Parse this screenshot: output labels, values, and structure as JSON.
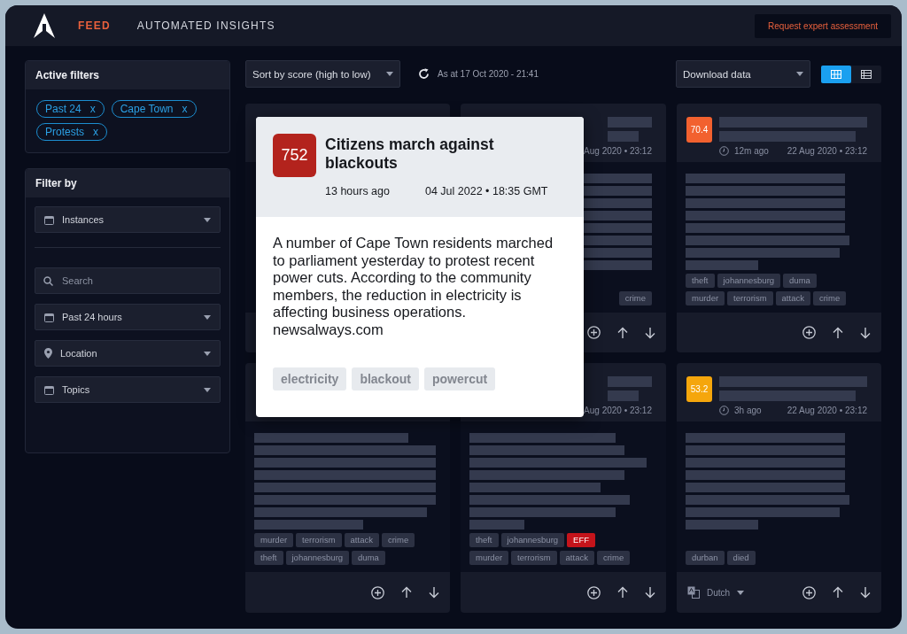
{
  "header": {
    "tabs": [
      {
        "label": "FEED",
        "selected": true
      },
      {
        "label": "AUTOMATED INSIGHTS",
        "selected": false
      }
    ],
    "action": "Request expert assessment"
  },
  "toolbar": {
    "sort": "Sort by score (high to low)",
    "timestamp": "As at 17 Oct 2020 - 21:41",
    "download": "Download data",
    "views": [
      {
        "kind": "grid",
        "selected": true
      },
      {
        "kind": "list",
        "selected": false
      }
    ]
  },
  "active_filters": {
    "title": "Active filters",
    "chips": [
      {
        "label": "Past 24",
        "remove": "x"
      },
      {
        "label": "Cape Town",
        "remove": "x"
      },
      {
        "label": "Protests",
        "remove": "x"
      }
    ]
  },
  "filter_by": {
    "title": "Filter by",
    "groups": [
      [
        {
          "kind": "select",
          "label": "Instances"
        }
      ],
      [
        {
          "kind": "search",
          "placeholder": "Search"
        },
        {
          "kind": "select",
          "label": "Past 24 hours"
        },
        {
          "kind": "location-select",
          "label": "Location"
        },
        {
          "kind": "select",
          "label": "Topics"
        }
      ]
    ]
  },
  "cards": [
    {
      "kind": "hidden"
    },
    {
      "kind": "left_hidden",
      "date": "Aug 2020 • 23:12",
      "tag_rows": [
        [
          {
            "label": "crime",
            "flagged": false
          }
        ]
      ]
    },
    {
      "kind": "full",
      "score": "70.4",
      "color": "#f2612f",
      "time_ago": "12m ago",
      "date": "22 Aug 2020 • 23:12",
      "tag_rows": [
        [
          {
            "label": "theft",
            "flagged": false
          },
          {
            "label": "johannesburg",
            "flagged": false
          },
          {
            "label": "duma",
            "flagged": false
          }
        ],
        [
          {
            "label": "murder",
            "flagged": false
          },
          {
            "label": "terrorism",
            "flagged": false
          },
          {
            "label": "attack",
            "flagged": false
          },
          {
            "label": "crime",
            "flagged": false
          }
        ]
      ]
    },
    {
      "kind": "header_hidden",
      "tag_rows": [
        [
          {
            "label": "murder",
            "flagged": false
          },
          {
            "label": "terrorism",
            "flagged": false
          },
          {
            "label": "attack",
            "flagged": false
          },
          {
            "label": "crime",
            "flagged": false
          }
        ],
        [
          {
            "label": "theft",
            "flagged": false
          },
          {
            "label": "johannesburg",
            "flagged": false
          },
          {
            "label": "duma",
            "flagged": false
          }
        ]
      ]
    },
    {
      "kind": "head_left_hidden",
      "date": "Aug 2020 • 23:12",
      "tag_rows": [
        [
          {
            "label": "theft",
            "flagged": false
          },
          {
            "label": "johannesburg",
            "flagged": false
          },
          {
            "label": "EFF",
            "flagged": true
          }
        ],
        [
          {
            "label": "murder",
            "flagged": false
          },
          {
            "label": "terrorism",
            "flagged": false
          },
          {
            "label": "attack",
            "flagged": false
          },
          {
            "label": "crime",
            "flagged": false
          }
        ]
      ]
    },
    {
      "kind": "full",
      "score": "53.2",
      "color": "#f5a60c",
      "time_ago": "3h ago",
      "date": "22 Aug 2020 • 23:12",
      "tag_rows": [
        [
          {
            "label": "durban",
            "flagged": false
          },
          {
            "label": "died",
            "flagged": false
          }
        ]
      ],
      "language": "Dutch"
    }
  ],
  "popup": {
    "score": "752",
    "title": "Citizens march against blackouts",
    "time_ago": "13 hours ago",
    "date": "04 Jul 2022 • 18:35 GMT",
    "body": "A number of Cape Town residents marched to parliament yesterday to protest recent power cuts. According to the community members, the reduction in electricity is affecting business operations. newsalways.com",
    "tags": [
      "electricity",
      "blackout",
      "powercut"
    ]
  }
}
